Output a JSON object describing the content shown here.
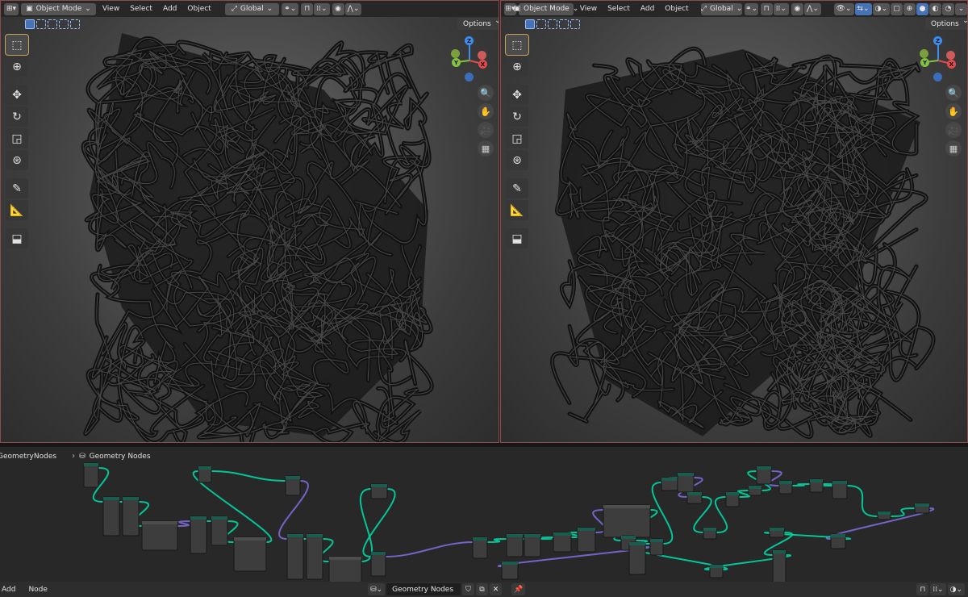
{
  "viewport_left": {
    "mode": "Object Mode",
    "menus": [
      "View",
      "Select",
      "Add",
      "Object"
    ],
    "orientation": "Global",
    "options": "Options",
    "gizmo_axes": [
      "Z",
      "Y",
      "X"
    ]
  },
  "viewport_right": {
    "mode": "Object Mode",
    "menus": [
      "View",
      "Select",
      "Add",
      "Object"
    ],
    "orientation": "Global",
    "options": "Options",
    "gizmo_axes": [
      "Z",
      "Y",
      "X"
    ]
  },
  "toolbar_tools": [
    "select-box",
    "cursor",
    "move",
    "rotate",
    "scale",
    "transform",
    "annotate",
    "measure",
    "add-cube"
  ],
  "navigation_icons": [
    "zoom-icon",
    "hand-pan-icon",
    "camera-icon",
    "grid-ortho-icon"
  ],
  "node_editor": {
    "breadcrumb_parent": "GeometryNodes",
    "breadcrumb_current": "Geometry Nodes"
  },
  "bottombar": {
    "menus": [
      "Add",
      "Node"
    ],
    "tree_name": "Geometry Nodes"
  },
  "colors": {
    "selected_outline": "#8e4b4b",
    "accent_blue": "#4772b3",
    "geometry_link": "#00d6a3",
    "axis_x": "#e04c4c",
    "axis_y": "#84c341",
    "axis_z": "#3b8ef0"
  }
}
